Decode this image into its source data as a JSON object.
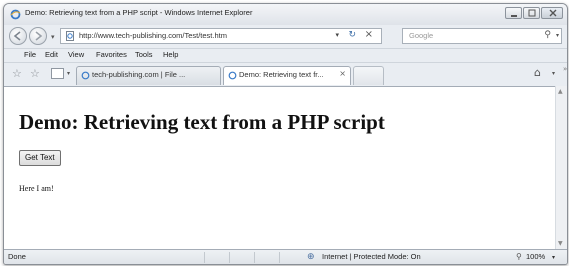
{
  "window": {
    "title": "Demo: Retrieving text from a PHP script - Windows Internet Explorer"
  },
  "address_bar": {
    "url": "http://www.tech-publishing.com/Test/test.htm",
    "refresh_glyph": "↻",
    "stop_glyph": "×"
  },
  "search": {
    "placeholder": "Google",
    "icon": "search-icon"
  },
  "menu": {
    "items": [
      "File",
      "Edit",
      "View",
      "Favorites",
      "Tools",
      "Help"
    ]
  },
  "tabs": [
    {
      "label": "tech-publishing.com | File ...",
      "active": false
    },
    {
      "label": "Demo: Retrieving text fr...",
      "active": true
    }
  ],
  "page": {
    "heading": "Demo: Retrieving text from a PHP script",
    "button_label": "Get Text",
    "output_text": "Here I am!"
  },
  "status_bar": {
    "status": "Done",
    "zone": "Internet | Protected Mode: On",
    "zoom": "100%"
  },
  "colors": {
    "chrome": "#e9edf2",
    "content_bg": "#ffffff",
    "accent": "#3d6ea8"
  }
}
